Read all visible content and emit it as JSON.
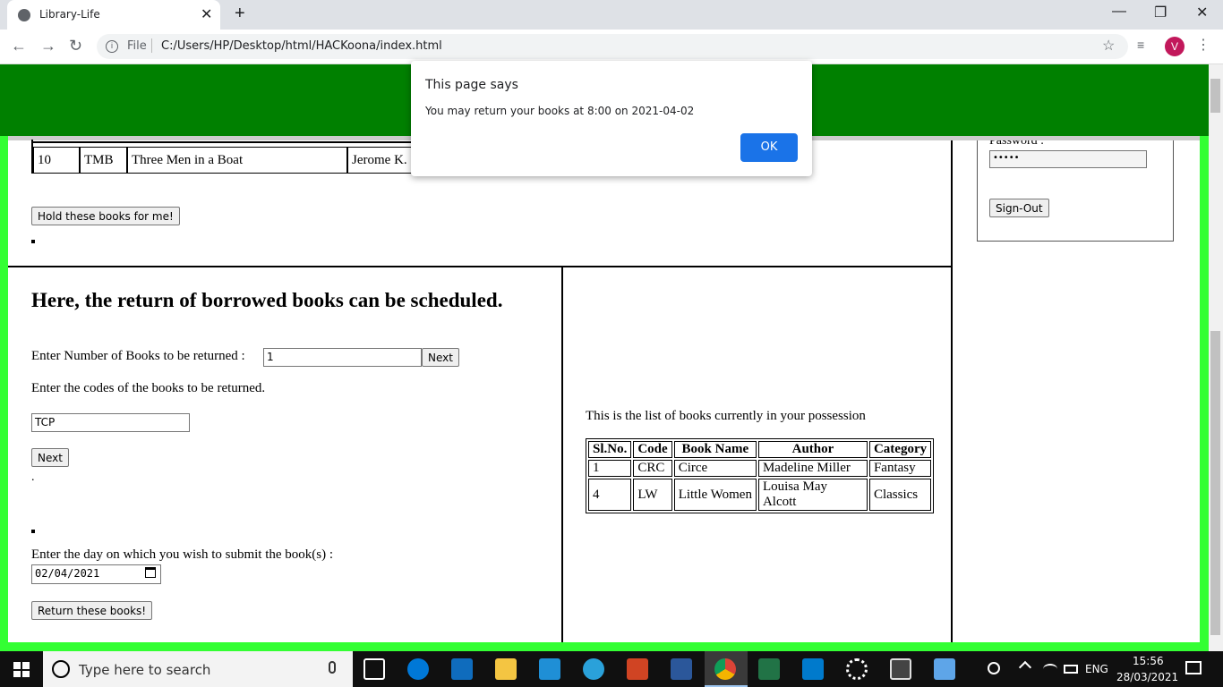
{
  "browser": {
    "tab_title": "Library-Life",
    "url_scheme": "File",
    "url": "C:/Users/HP/Desktop/html/HACKoona/index.html",
    "profile_initial": "V",
    "tab_close": "✕",
    "new_tab": "+",
    "win_min": "—",
    "win_restore": "❐",
    "win_close": "✕",
    "back": "←",
    "forward": "→",
    "reload": "↻",
    "star": "☆",
    "media": "≡",
    "kebab": "⋮",
    "info": "i"
  },
  "hold_table": {
    "row": {
      "sl": "10",
      "code": "TMB",
      "name": "Three Men in a Boat",
      "author": "Jerome K."
    }
  },
  "hold_button": "Hold these books for me!",
  "sidebar": {
    "password_label": "Password :",
    "password_value": "•••••",
    "signout_button": "Sign-Out"
  },
  "return_section": {
    "heading": "Here, the return of borrowed books can be scheduled.",
    "num_label": "Enter Number of Books to be returned :",
    "num_value": "1",
    "next_button": "Next",
    "codes_label": "Enter the codes of the books to be returned.",
    "code_value": "TCP",
    "next_button2": "Next",
    "dot": ".",
    "date_label": "Enter the day on which you wish to submit the book(s) :",
    "date_value": "02/04/2021",
    "return_button": "Return these books!"
  },
  "possession": {
    "caption": "This is the list of books currently in your possession",
    "headers": [
      "Sl.No.",
      "Code",
      "Book Name",
      "Author",
      "Category"
    ],
    "rows": [
      [
        "1",
        "CRC",
        "Circe",
        "Madeline Miller",
        "Fantasy"
      ],
      [
        "4",
        "LW",
        "Little Women",
        "Louisa May Alcott",
        "Classics"
      ]
    ]
  },
  "dialog": {
    "title": "This page says",
    "message": "You may return your books at 8:00 on 2021-04-02",
    "ok": "OK"
  },
  "taskbar": {
    "search_placeholder": "Type here to search",
    "lang": "ENG",
    "time": "15:56",
    "date": "28/03/2021"
  }
}
